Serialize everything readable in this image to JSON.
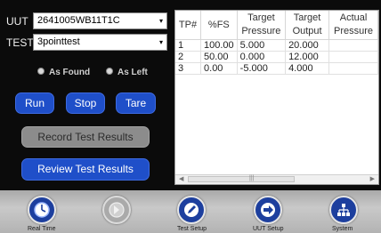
{
  "uut": {
    "label": "UUT",
    "value": "2641005WB11T1C"
  },
  "test": {
    "label": "TEST",
    "value": "3pointtest"
  },
  "radios": {
    "as_found": "As Found",
    "as_left": "As Left"
  },
  "buttons": {
    "run": "Run",
    "stop": "Stop",
    "tare": "Tare",
    "record": "Record Test Results",
    "review": "Review Test Results"
  },
  "table": {
    "headers": {
      "tp": "TP#",
      "fs": "%FS",
      "target_pressure_1": "Target",
      "target_pressure_2": "Pressure",
      "target_output_1": "Target",
      "target_output_2": "Output",
      "actual_pressure_1": "Actual",
      "actual_pressure_2": "Pressure"
    },
    "rows": [
      {
        "tp": "1",
        "fs": "100.00",
        "target_pressure": "5.000",
        "target_output": "20.000",
        "actual_pressure": ""
      },
      {
        "tp": "2",
        "fs": "50.00",
        "target_pressure": "0.000",
        "target_output": "12.000",
        "actual_pressure": ""
      },
      {
        "tp": "3",
        "fs": "0.00",
        "target_pressure": "-5.000",
        "target_output": "4.000",
        "actual_pressure": ""
      }
    ]
  },
  "nav": {
    "real_time": "Real Time",
    "test_setup": "Test Setup",
    "uut_setup": "UUT Setup",
    "system": "System"
  },
  "icons": {
    "real_time": "clock-icon",
    "disabled": "arrow-right-icon",
    "test_setup": "pencil-icon",
    "uut_setup": "arrow-right-icon",
    "system": "network-icon"
  },
  "colors": {
    "accent_blue": "#1f4fc9",
    "nav_button": "#1d3f9e",
    "disabled_button": "#8c8c8c"
  }
}
